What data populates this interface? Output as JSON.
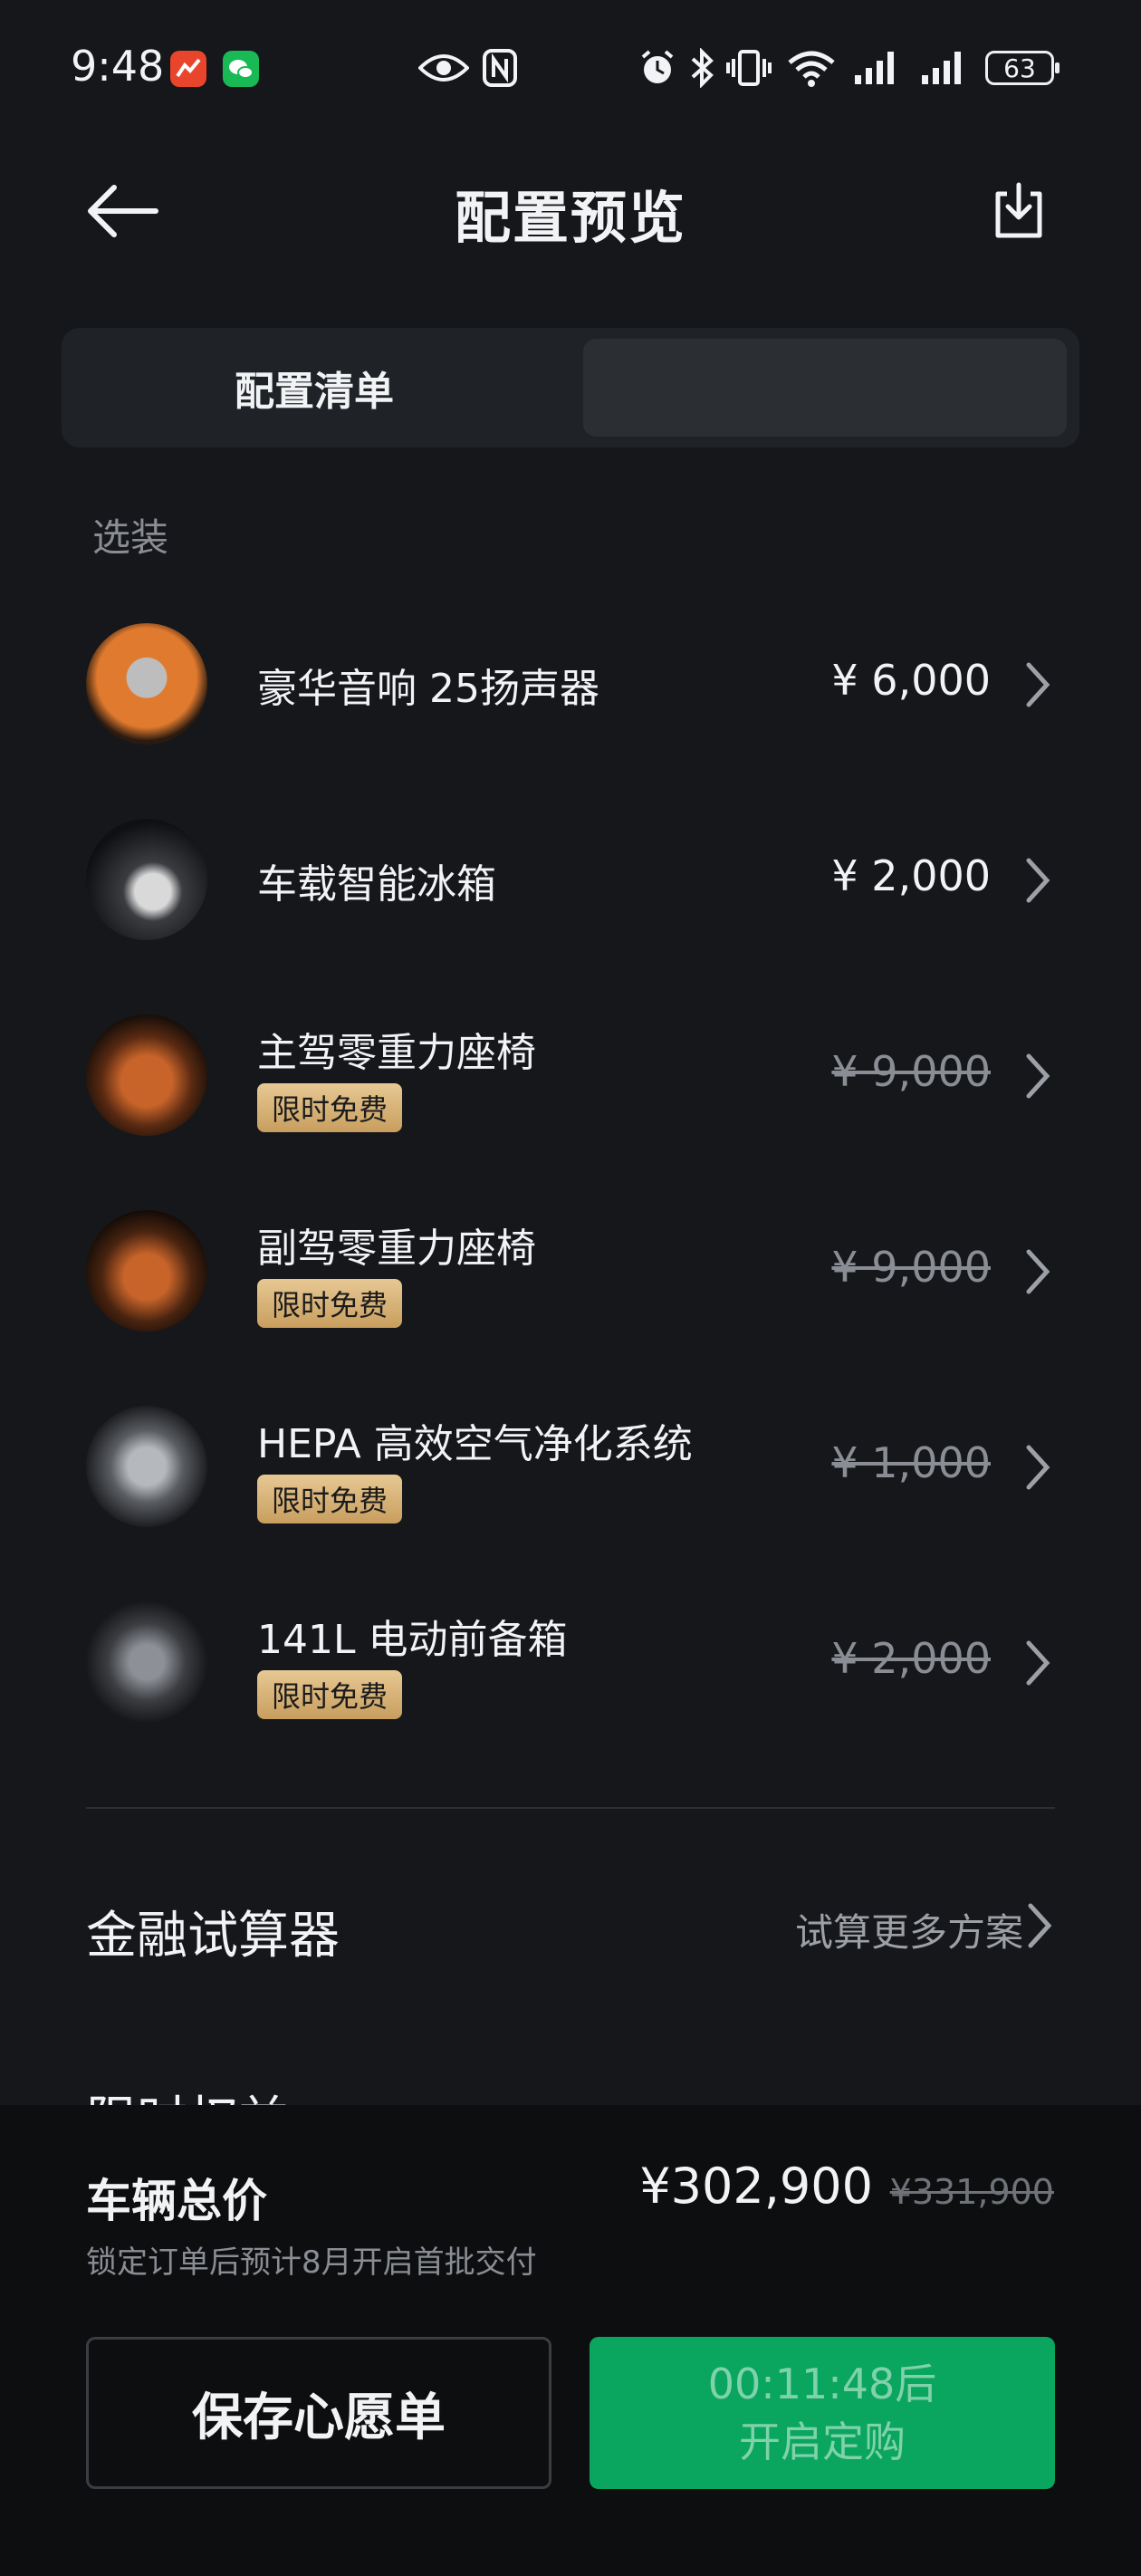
{
  "status_bar": {
    "time": "9:48",
    "battery": "63"
  },
  "header": {
    "title": "配置预览"
  },
  "tabs": [
    {
      "label": "配置清单"
    },
    {
      "label": ""
    }
  ],
  "section": {
    "label": "选装"
  },
  "items": [
    {
      "name": "豪华音响 25扬声器",
      "price": "¥ 6,000",
      "badge": "",
      "strike": false
    },
    {
      "name": "车载智能冰箱",
      "price": "¥ 2,000",
      "badge": "",
      "strike": false
    },
    {
      "name": "主驾零重力座椅",
      "price": "¥ 9,000",
      "badge": "限时免费",
      "strike": true
    },
    {
      "name": "副驾零重力座椅",
      "price": "¥ 9,000",
      "badge": "限时免费",
      "strike": true
    },
    {
      "name": "HEPA 高效空气净化系统",
      "price": "¥ 1,000",
      "badge": "限时免费",
      "strike": true
    },
    {
      "name": "141L 电动前备箱",
      "price": "¥ 2,000",
      "badge": "限时免费",
      "strike": true
    }
  ],
  "finance": {
    "title": "金融试算器",
    "link": "试算更多方案"
  },
  "next_section_peek": "限时权益",
  "footer": {
    "total_label": "车辆总价",
    "total_price": "¥302,900",
    "original_price": "¥331,900",
    "delivery_note": "锁定订单后预计8月开启首批交付",
    "save_button": "保存心愿单",
    "order_countdown": "00:11:48后",
    "order_label": "开启定购"
  },
  "colors": {
    "accent_green": "#0aa55e",
    "background": "#15171b",
    "badge_gold": "#d9b57a"
  },
  "icons": [
    "back-arrow-icon",
    "download-icon",
    "chevron-right-icon",
    "eye-icon",
    "nfc-icon",
    "alarm-icon",
    "bluetooth-icon",
    "vibrate-icon",
    "wifi-icon",
    "signal-icon",
    "battery-icon"
  ]
}
